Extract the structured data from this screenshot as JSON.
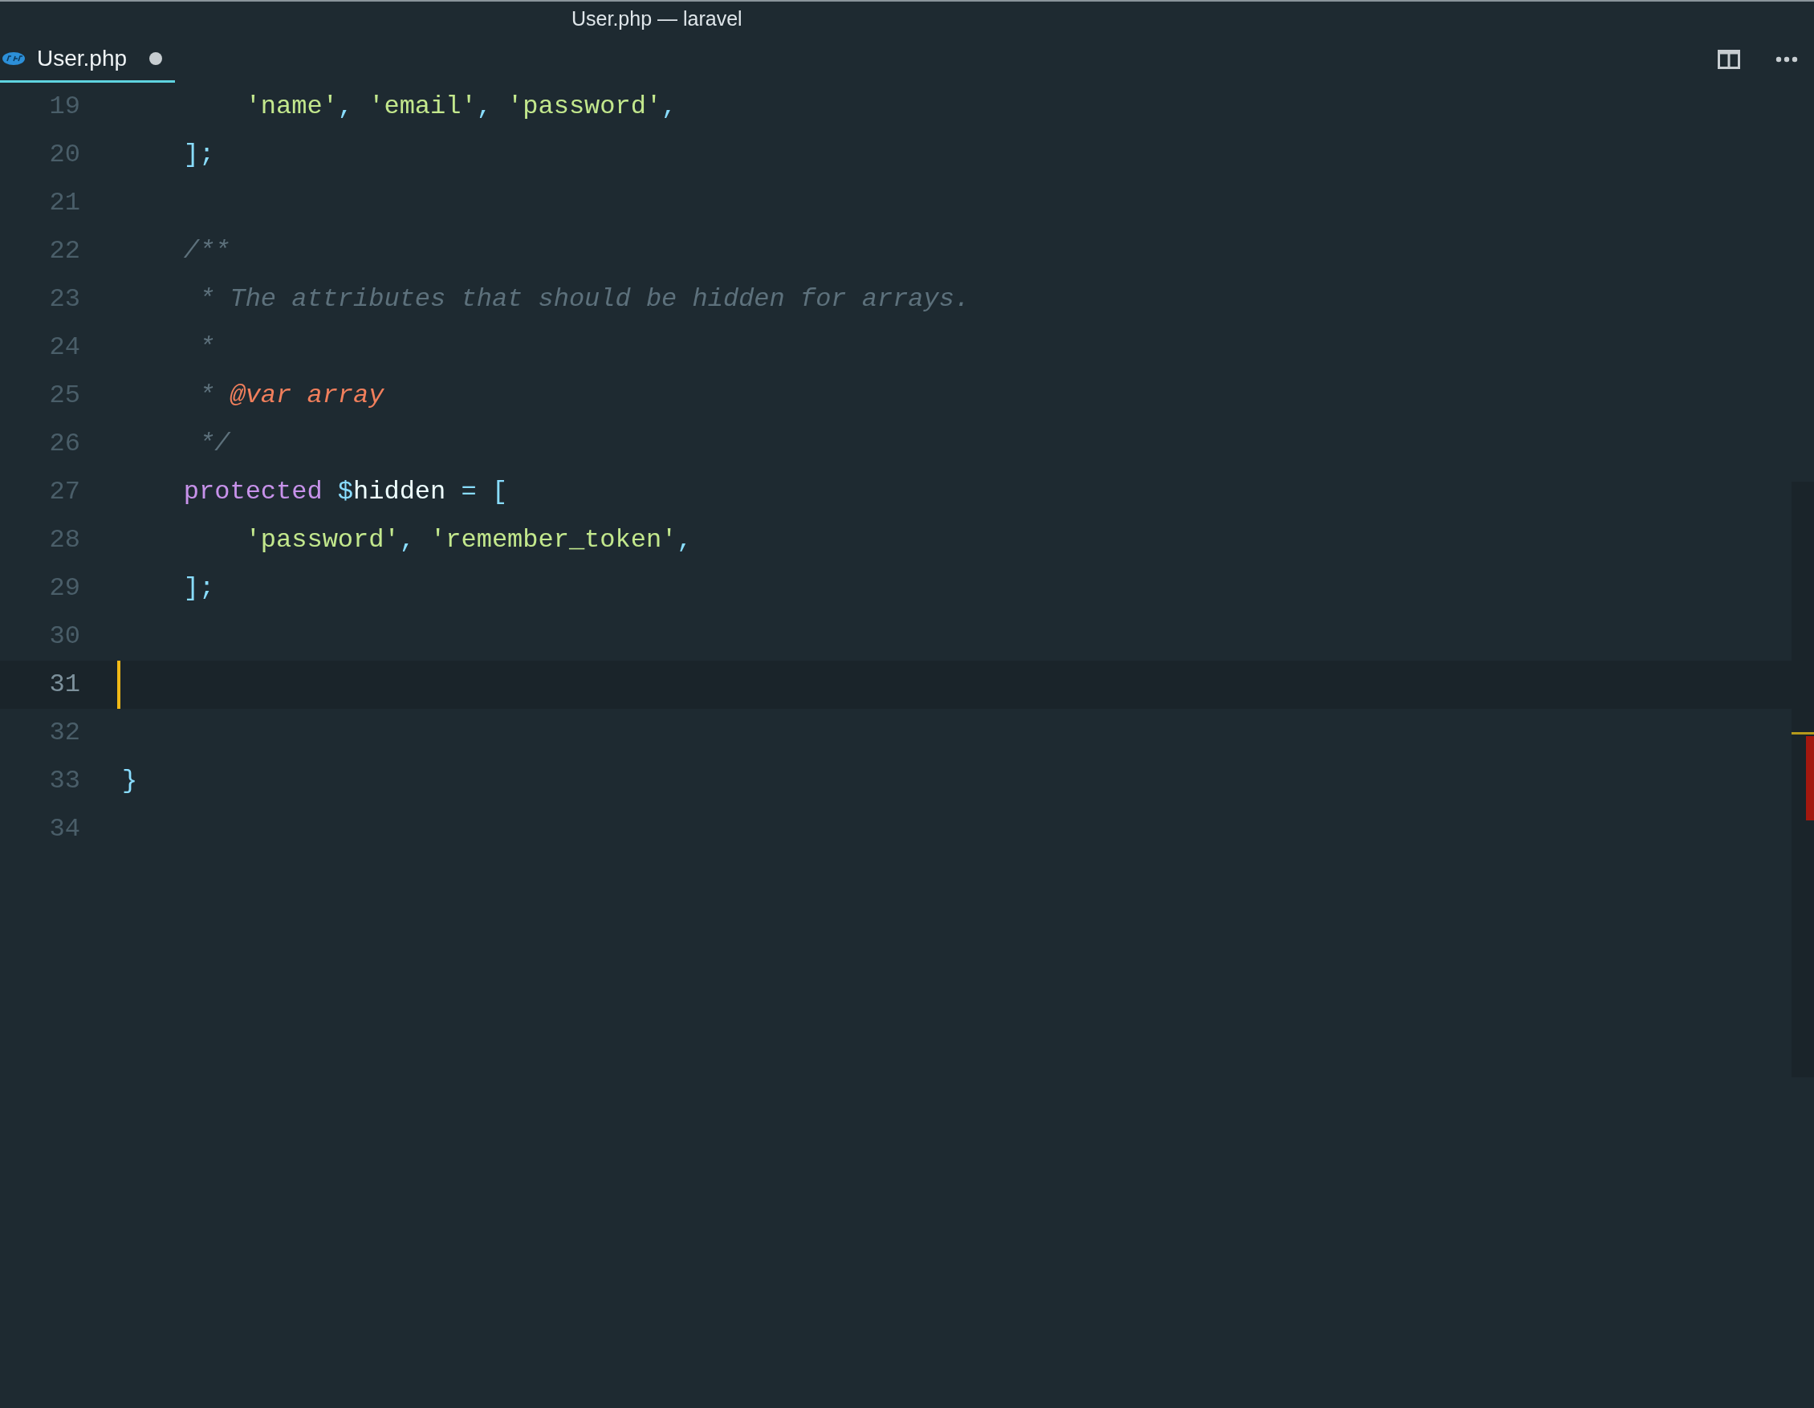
{
  "window": {
    "title": "User.php — laravel"
  },
  "tabs": [
    {
      "label": "User.php",
      "selected": true,
      "modified": true
    }
  ],
  "editor": {
    "lines": [
      {
        "number": "19",
        "current": false,
        "tokens": [
          {
            "kind": "string",
            "text": "        'name'"
          },
          {
            "kind": "punct",
            "text": ", "
          },
          {
            "kind": "string",
            "text": "'email'"
          },
          {
            "kind": "punct",
            "text": ", "
          },
          {
            "kind": "string",
            "text": "'password'"
          },
          {
            "kind": "punct",
            "text": ","
          }
        ]
      },
      {
        "number": "20",
        "current": false,
        "tokens": [
          {
            "kind": "punct",
            "text": "    ];"
          }
        ]
      },
      {
        "number": "21",
        "current": false
      },
      {
        "number": "22",
        "current": false,
        "tokens": [
          {
            "kind": "comment",
            "text": "    /**"
          }
        ]
      },
      {
        "number": "23",
        "current": false,
        "tokens": [
          {
            "kind": "comment",
            "text": "     * The attributes that should be hidden for arrays."
          }
        ]
      },
      {
        "number": "24",
        "current": false,
        "tokens": [
          {
            "kind": "comment",
            "text": "     *"
          }
        ]
      },
      {
        "number": "25",
        "current": false,
        "tokens": [
          {
            "kind": "comment",
            "text": "     *"
          },
          {
            "kind": "doctag",
            "text": " @var array"
          }
        ]
      },
      {
        "number": "26",
        "current": false,
        "tokens": [
          {
            "kind": "comment",
            "text": "     */"
          }
        ]
      },
      {
        "number": "27",
        "current": false,
        "tokens": [
          {
            "kind": "keyword",
            "text": "    protected"
          },
          {
            "kind": "punct",
            "text": " $"
          },
          {
            "kind": "variable",
            "text": "hidden"
          },
          {
            "kind": "punct",
            "text": " = ["
          }
        ]
      },
      {
        "number": "28",
        "current": false,
        "tokens": [
          {
            "kind": "string",
            "text": "        'password'"
          },
          {
            "kind": "punct",
            "text": ", "
          },
          {
            "kind": "string",
            "text": "'remember_token'"
          },
          {
            "kind": "punct",
            "text": ","
          }
        ]
      },
      {
        "number": "29",
        "current": false,
        "tokens": [
          {
            "kind": "punct",
            "text": "    ];"
          }
        ]
      },
      {
        "number": "30",
        "current": false
      },
      {
        "number": "31",
        "current": true
      },
      {
        "number": "32",
        "current": false
      },
      {
        "number": "33",
        "current": false,
        "tokens": [
          {
            "kind": "punct",
            "text": "}"
          }
        ]
      },
      {
        "number": "34",
        "current": false
      }
    ]
  }
}
